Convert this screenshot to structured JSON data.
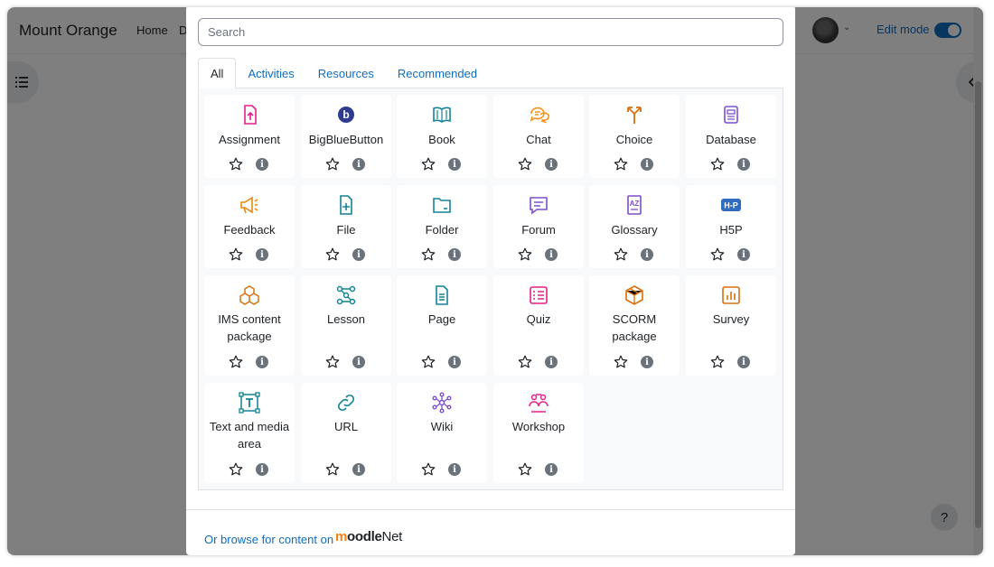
{
  "navbar": {
    "site_name": "Mount Orange",
    "home": "Home",
    "partial_item": "D",
    "edit_mode_label": "Edit mode",
    "edit_mode_on": true
  },
  "help_label": "?",
  "chooser": {
    "search_placeholder": "Search",
    "tabs": [
      {
        "label": "All",
        "active": true
      },
      {
        "label": "Activities",
        "active": false
      },
      {
        "label": "Resources",
        "active": false
      },
      {
        "label": "Recommended",
        "active": false
      }
    ],
    "items": [
      {
        "name": "Assignment",
        "icon": "assignment-icon",
        "color": "#e61e8c"
      },
      {
        "name": "BigBlueButton",
        "icon": "bigbluebutton-icon",
        "color": "#2f3b8f"
      },
      {
        "name": "Book",
        "icon": "book-icon",
        "color": "#138496"
      },
      {
        "name": "Chat",
        "icon": "chat-icon",
        "color": "#f7921e"
      },
      {
        "name": "Choice",
        "icon": "choice-icon",
        "color": "#d9700b"
      },
      {
        "name": "Database",
        "icon": "database-icon",
        "color": "#7e4ecd"
      },
      {
        "name": "Feedback",
        "icon": "feedback-icon",
        "color": "#e88a0b"
      },
      {
        "name": "File",
        "icon": "file-icon",
        "color": "#138496"
      },
      {
        "name": "Folder",
        "icon": "folder-icon",
        "color": "#138496"
      },
      {
        "name": "Forum",
        "icon": "forum-icon",
        "color": "#7e4ecd"
      },
      {
        "name": "Glossary",
        "icon": "glossary-icon",
        "color": "#7e4ecd"
      },
      {
        "name": "H5P",
        "icon": "h5p-icon",
        "color": "#2f6bbf"
      },
      {
        "name": "IMS content package",
        "icon": "ims-package-icon",
        "color": "#d9700b"
      },
      {
        "name": "Lesson",
        "icon": "lesson-icon",
        "color": "#138496"
      },
      {
        "name": "Page",
        "icon": "page-icon",
        "color": "#138496"
      },
      {
        "name": "Quiz",
        "icon": "quiz-icon",
        "color": "#e61e8c"
      },
      {
        "name": "SCORM package",
        "icon": "scorm-icon",
        "color": "#d9700b"
      },
      {
        "name": "Survey",
        "icon": "survey-icon",
        "color": "#d9700b"
      },
      {
        "name": "Text and media area",
        "icon": "text-media-icon",
        "color": "#138496"
      },
      {
        "name": "URL",
        "icon": "url-icon",
        "color": "#138496"
      },
      {
        "name": "Wiki",
        "icon": "wiki-icon",
        "color": "#7e4ecd"
      },
      {
        "name": "Workshop",
        "icon": "workshop-icon",
        "color": "#e61e8c"
      }
    ],
    "footer": {
      "text": "Or browse for content on",
      "brand_m": "m",
      "brand_oodle": "oodle",
      "brand_net": "Net"
    }
  }
}
